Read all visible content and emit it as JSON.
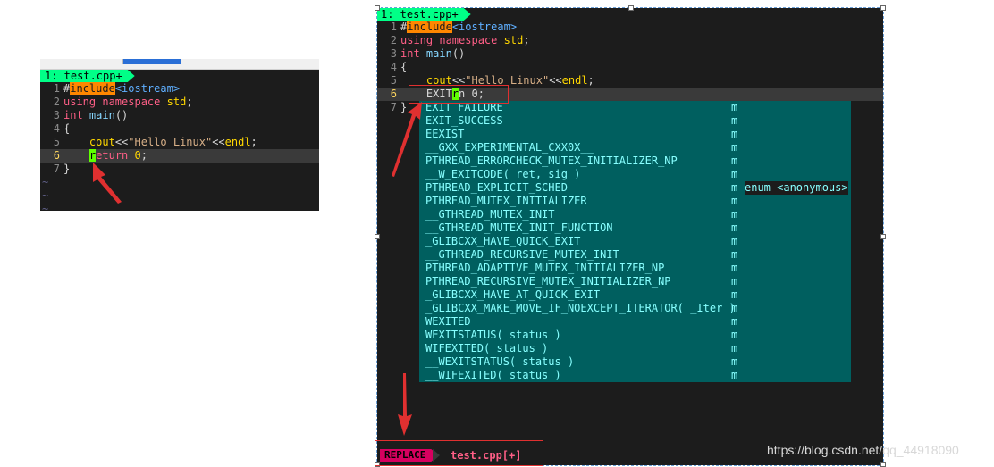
{
  "left_editor": {
    "tab_label": "1: test.cpp+",
    "lines": [
      {
        "num": "1",
        "parts": [
          [
            "pp",
            "#"
          ],
          [
            "inc",
            "include"
          ],
          [
            "ty",
            "<iostream>"
          ]
        ]
      },
      {
        "num": "2",
        "parts": [
          [
            "kw",
            "using"
          ],
          [
            "op",
            " "
          ],
          [
            "kw",
            "namespace"
          ],
          [
            "op",
            " "
          ],
          [
            "id",
            "std"
          ],
          [
            "op",
            ";"
          ]
        ]
      },
      {
        "num": "3",
        "parts": [
          [
            "kw",
            "int"
          ],
          [
            "op",
            " "
          ],
          [
            "fn",
            "main"
          ],
          [
            "op",
            "()"
          ]
        ]
      },
      {
        "num": "4",
        "parts": [
          [
            "op",
            "{"
          ]
        ]
      },
      {
        "num": "5",
        "parts": [
          [
            "op",
            "    "
          ],
          [
            "id",
            "cout"
          ],
          [
            "op",
            "<<"
          ],
          [
            "st",
            "\"Hello Linux\""
          ],
          [
            "op",
            "<<"
          ],
          [
            "id",
            "endl"
          ],
          [
            "op",
            ";"
          ]
        ]
      },
      {
        "num": "6",
        "current": true,
        "parts": [
          [
            "op",
            "    "
          ],
          [
            "cursor",
            "r"
          ],
          [
            "kw",
            "eturn"
          ],
          [
            "op",
            " "
          ],
          [
            "id",
            "0"
          ],
          [
            "op",
            ";"
          ]
        ]
      },
      {
        "num": "7",
        "parts": [
          [
            "op",
            "}"
          ]
        ]
      }
    ],
    "tildes": [
      "~",
      "~",
      "~"
    ]
  },
  "right_editor": {
    "tab_label": "1: test.cpp+",
    "lines": [
      {
        "num": "1",
        "parts": [
          [
            "pp",
            "#"
          ],
          [
            "inc",
            "include"
          ],
          [
            "ty",
            "<iostream>"
          ]
        ]
      },
      {
        "num": "2",
        "parts": [
          [
            "kw",
            "using"
          ],
          [
            "op",
            " "
          ],
          [
            "kw",
            "namespace"
          ],
          [
            "op",
            " "
          ],
          [
            "id",
            "std"
          ],
          [
            "op",
            ";"
          ]
        ]
      },
      {
        "num": "3",
        "parts": [
          [
            "kw",
            "int"
          ],
          [
            "op",
            " "
          ],
          [
            "fn",
            "main"
          ],
          [
            "op",
            "()"
          ]
        ]
      },
      {
        "num": "4",
        "parts": [
          [
            "op",
            "{"
          ]
        ]
      },
      {
        "num": "5",
        "parts": [
          [
            "op",
            "    "
          ],
          [
            "id",
            "cout"
          ],
          [
            "op",
            "<<"
          ],
          [
            "st",
            "\"Hello Linux\""
          ],
          [
            "op",
            "<<"
          ],
          [
            "id",
            "endl"
          ],
          [
            "op",
            ";"
          ]
        ]
      },
      {
        "num": "6",
        "current": true,
        "parts": [
          [
            "op",
            "    EXIT"
          ],
          [
            "cursor",
            "r"
          ],
          [
            "op",
            "n 0;"
          ]
        ]
      },
      {
        "num": "7",
        "parts": [
          [
            "op",
            "}"
          ]
        ]
      }
    ],
    "completion": [
      {
        "word": "EXIT_FAILURE",
        "kind": "m"
      },
      {
        "word": "EXIT_SUCCESS",
        "kind": "m"
      },
      {
        "word": "EEXIST",
        "kind": "m"
      },
      {
        "word": "__GXX_EXPERIMENTAL_CXX0X__",
        "kind": "m"
      },
      {
        "word": "PTHREAD_ERRORCHECK_MUTEX_INITIALIZER_NP",
        "kind": "m"
      },
      {
        "word": "__W_EXITCODE( ret, sig )",
        "kind": "m"
      },
      {
        "word": "PTHREAD_EXPLICIT_SCHED",
        "kind": "m",
        "extra": "enum <anonymous>"
      },
      {
        "word": "PTHREAD_MUTEX_INITIALIZER",
        "kind": "m"
      },
      {
        "word": "__GTHREAD_MUTEX_INIT",
        "kind": "m"
      },
      {
        "word": "__GTHREAD_MUTEX_INIT_FUNCTION",
        "kind": "m"
      },
      {
        "word": "_GLIBCXX_HAVE_QUICK_EXIT",
        "kind": "m"
      },
      {
        "word": "__GTHREAD_RECURSIVE_MUTEX_INIT",
        "kind": "m"
      },
      {
        "word": "PTHREAD_ADAPTIVE_MUTEX_INITIALIZER_NP",
        "kind": "m"
      },
      {
        "word": "PTHREAD_RECURSIVE_MUTEX_INITIALIZER_NP",
        "kind": "m"
      },
      {
        "word": "_GLIBCXX_HAVE_AT_QUICK_EXIT",
        "kind": "m"
      },
      {
        "word": "_GLIBCXX_MAKE_MOVE_IF_NOEXCEPT_ITERATOR( _Iter )",
        "kind": "m"
      },
      {
        "word": "WEXITED",
        "kind": "m"
      },
      {
        "word": "WEXITSTATUS( status )",
        "kind": "m"
      },
      {
        "word": "WIFEXITED( status )",
        "kind": "m"
      },
      {
        "word": "__WEXITSTATUS( status )",
        "kind": "m"
      },
      {
        "word": "__WIFEXITED( status )",
        "kind": "m"
      }
    ],
    "status": {
      "mode": "REPLACE",
      "file": "test.cpp[+]"
    }
  },
  "watermark": "https://blog.csdn.net/qq_44918090",
  "colors": {
    "annotation": "#e03030",
    "popup_bg": "#005f5f",
    "tab_bg": "#00ff87",
    "mode_bg": "#d7005f"
  }
}
